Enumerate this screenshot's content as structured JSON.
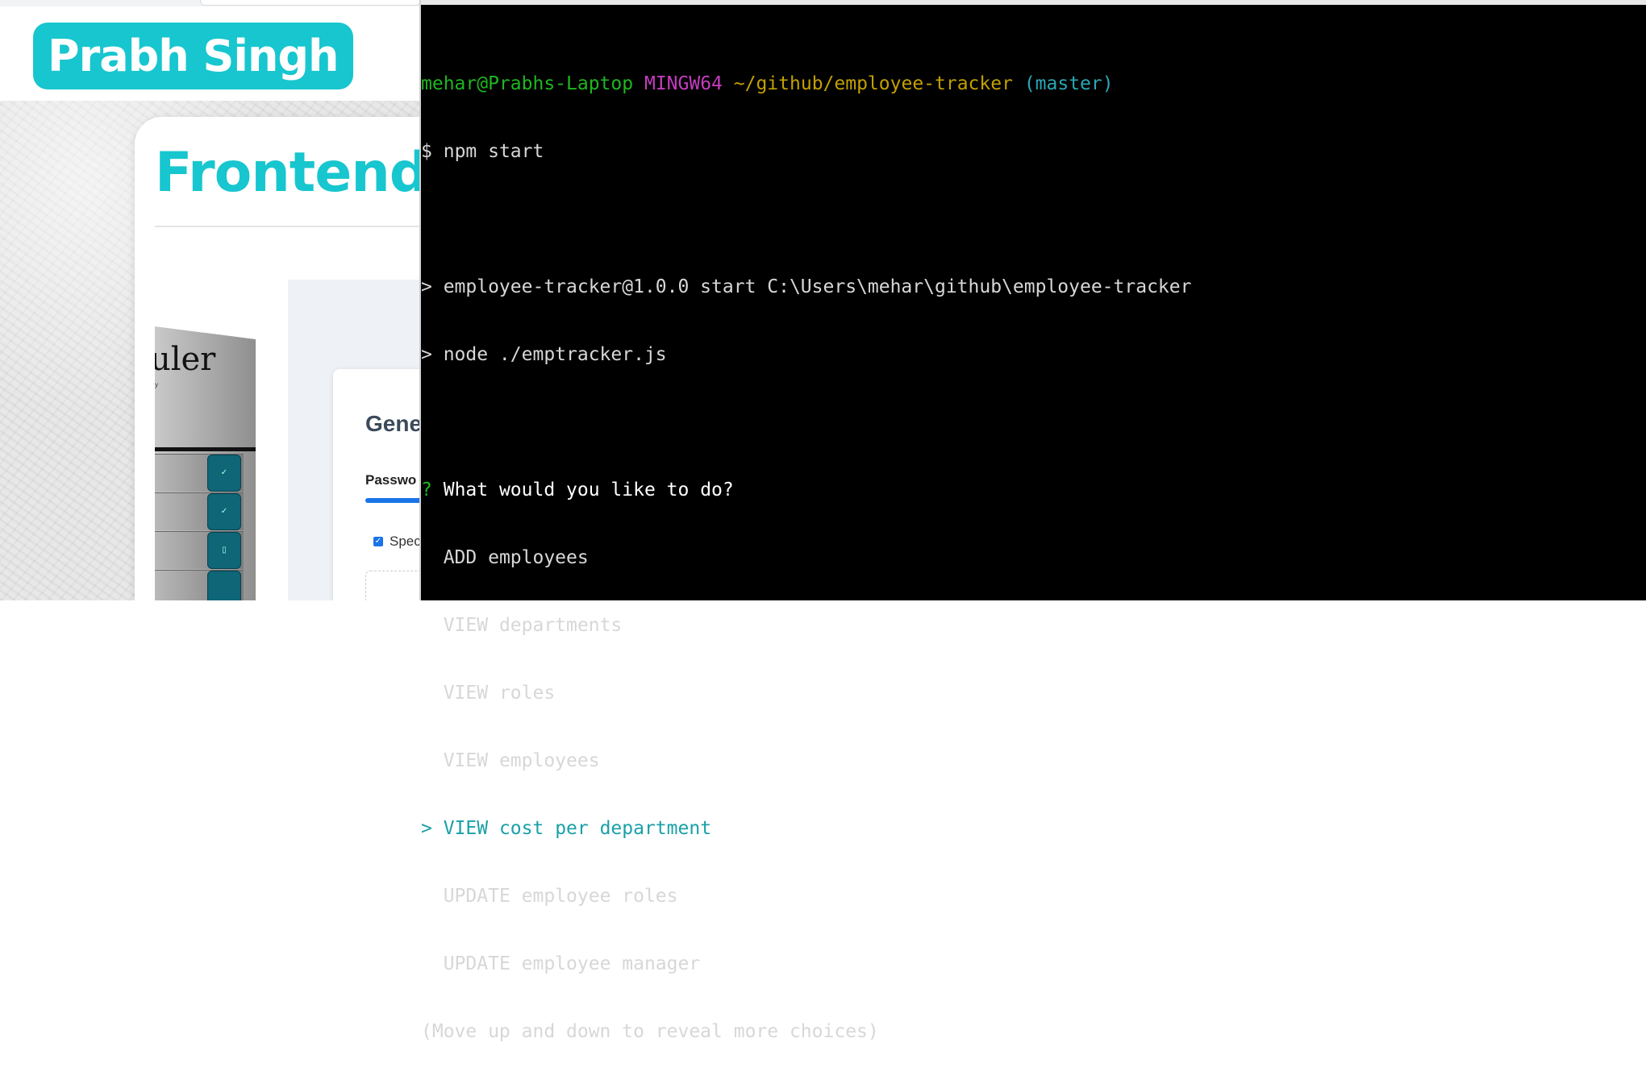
{
  "portfolio": {
    "brand_name": "Prabh Singh",
    "section_title": "Frontend",
    "scheduler_text": "uler",
    "scheduler_subtext": "y",
    "password_card_title": "Gene",
    "password_label": "Passwo",
    "checkbox_label": "Spec",
    "lock_icons": [
      "✓",
      "✓",
      "▯"
    ]
  },
  "terminal": {
    "prompt": {
      "user_host": "mehar@Prabhs-Laptop",
      "shell": "MINGW64",
      "path": "~/github/employee-tracker",
      "branch": "(master)"
    },
    "command_symbol": "$",
    "command": "npm start",
    "output_lines": [
      "> employee-tracker@1.0.0 start C:\\Users\\mehar\\github\\employee-tracker",
      "> node ./emptracker.js"
    ],
    "question_mark": "?",
    "question": "What would you like to do?",
    "choices": [
      {
        "label": "ADD employees",
        "selected": false
      },
      {
        "label": "VIEW departments",
        "selected": false
      },
      {
        "label": "VIEW roles",
        "selected": false
      },
      {
        "label": "VIEW employees",
        "selected": false
      },
      {
        "label": "VIEW cost per department",
        "selected": true
      },
      {
        "label": "UPDATE employee roles",
        "selected": false
      },
      {
        "label": "UPDATE employee manager",
        "selected": false
      }
    ],
    "selection_pointer": ">",
    "hint": "(Move up and down to reveal more choices)"
  },
  "colors": {
    "brand": "#17c6cf",
    "terminal_background": "#000000",
    "prompt_user": "#1fb61f",
    "prompt_shell": "#c43cbf",
    "prompt_path": "#c2a000",
    "prompt_branch": "#2aa7b5",
    "selected_choice": "#1aa0a8"
  }
}
